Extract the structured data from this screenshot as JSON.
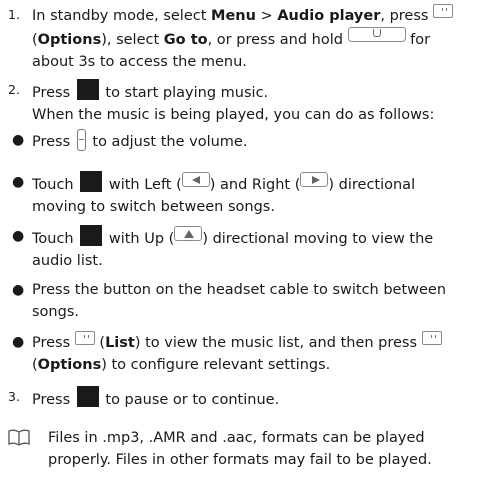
{
  "steps": {
    "s1": {
      "number": "1.",
      "t1": "In standby mode, select ",
      "menu": "Menu",
      "sep": " > ",
      "audio": "Audio player",
      "t2": ", press ",
      "t3": "(",
      "options": "Options",
      "t4": "), select ",
      "goto": "Go to",
      "t5": ", or press and hold ",
      "t6": " for about 3s to access the menu."
    },
    "s2": {
      "number": "2.",
      "t1": "Press ",
      "t2": " to start playing music.",
      "t3": "When the music is being played, you can do as follows:"
    },
    "s3": {
      "number": "3.",
      "t1": "Press ",
      "t2": " to pause or to continue."
    }
  },
  "bullets": {
    "b1": {
      "t1": "Press ",
      "t2": " to adjust the volume."
    },
    "b2": {
      "t1": "Touch ",
      "t2": " with Left (",
      "t3": ") and Right (",
      "t4": ") directional moving to switch between songs."
    },
    "b3": {
      "t1": "Touch ",
      "t2": " with Up (",
      "t3": ") directional moving to view the audio list."
    },
    "b4": {
      "t1": "Press the button on the headset cable to switch between songs."
    },
    "b5": {
      "t1": "Press ",
      "t2": " (",
      "list": "List",
      "t3": ") to view the music list, and then press ",
      "t4": "(",
      "options": "Options",
      "t5": ") to configure relevant settings."
    }
  },
  "note": {
    "text": "Files in .mp3, .AMR and .aac, formats can be played properly. Files in other formats may fail to be played."
  },
  "icons": {
    "options_key": "options-key-icon",
    "music_key": "music-key-icon",
    "nav_pad": "navigation-pad-icon",
    "volume_key": "volume-key-icon",
    "left_arrow": "left-arrow-icon",
    "right_arrow": "right-arrow-icon",
    "up_arrow": "up-arrow-icon",
    "note": "book-note-icon"
  }
}
